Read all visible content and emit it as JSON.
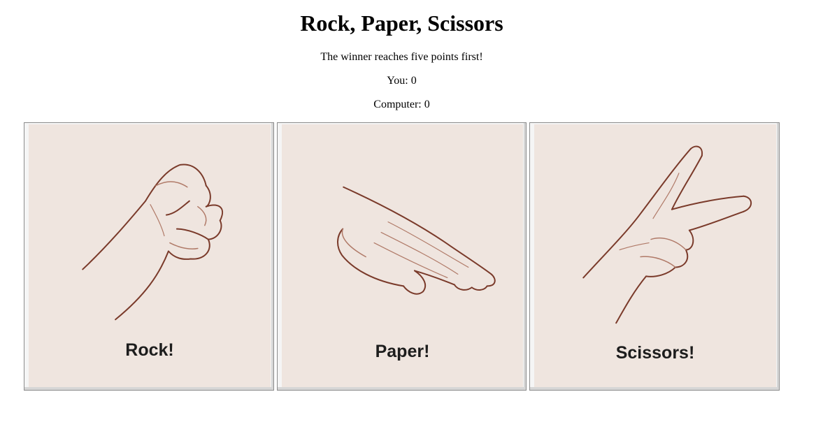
{
  "game": {
    "title": "Rock, Paper, Scissors",
    "rules": "The winner reaches five points first!",
    "score_you": "You: 0",
    "score_computer": "Computer: 0"
  },
  "choices": [
    {
      "id": "rock",
      "label": "Rock!",
      "icon": "fist-hand-icon"
    },
    {
      "id": "paper",
      "label": "Paper!",
      "icon": "flat-hand-icon"
    },
    {
      "id": "scissors",
      "label": "Scissors!",
      "icon": "two-finger-hand-icon"
    }
  ],
  "colors": {
    "card_background": "#efe5df",
    "sketch_line": "#7a3a2a",
    "sketch_shade": "#b07a68"
  }
}
